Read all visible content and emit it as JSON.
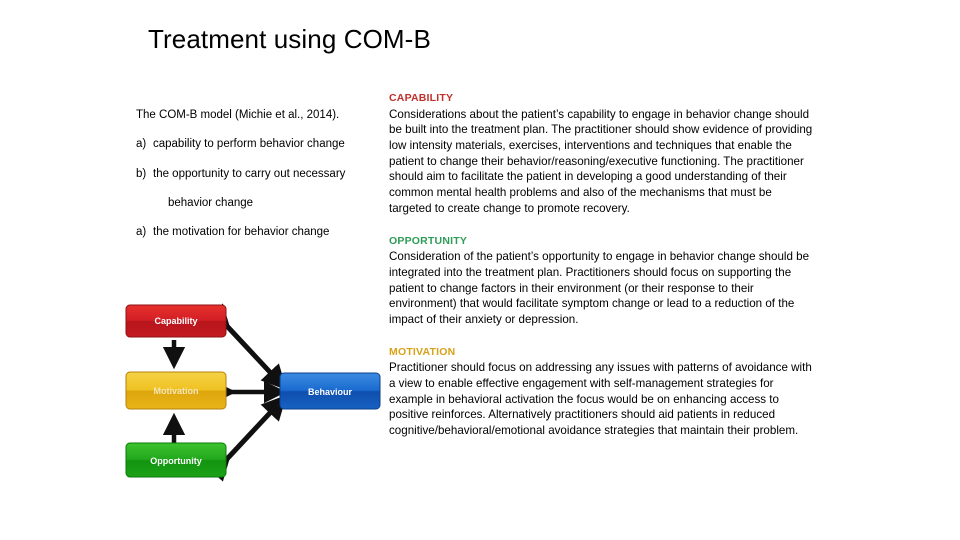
{
  "slide": {
    "title": "Treatment using COM-B"
  },
  "left_column": {
    "lead_paragraph": "The COM-B model (Michie et al., 2014).",
    "items": [
      {
        "marker": "a)",
        "text": "capability to perform behavior change"
      },
      {
        "marker": "b)",
        "text": "the opportunity to carry out necessary"
      }
    ],
    "indented_line": "behavior change",
    "final_item": {
      "marker": "a)",
      "text": "the motivation for behavior change"
    }
  },
  "diagram": {
    "name": "com-b-model-diagram",
    "nodes": [
      {
        "id": "capability",
        "label": "Capability",
        "color": "#D21F26"
      },
      {
        "id": "motivation",
        "label": "Motivation",
        "color": "#E8B114"
      },
      {
        "id": "opportunity",
        "label": "Opportunity",
        "color": "#22A81C"
      },
      {
        "id": "behaviour",
        "label": "Behaviour",
        "color": "#1461C6"
      }
    ],
    "arrows": [
      {
        "from": "capability",
        "to": "motivation",
        "style": "single"
      },
      {
        "from": "opportunity",
        "to": "motivation",
        "style": "single"
      },
      {
        "from": "motivation",
        "to": "behaviour",
        "style": "double"
      },
      {
        "from": "capability",
        "to": "behaviour",
        "style": "double"
      },
      {
        "from": "opportunity",
        "to": "behaviour",
        "style": "double"
      }
    ]
  },
  "right_column": {
    "sections": [
      {
        "heading": "CAPABILITY",
        "color": "#C0302B",
        "body": "Considerations about the patient’s capability to engage in behavior change should be built into the treatment plan.  The practitioner should show evidence of providing low intensity materials, exercises, interventions and techniques that enable the patient to change their behavior/reasoning/executive functioning.  The practitioner should aim to facilitate the patient in developing a good understanding of their common mental health problems and also of the mechanisms that must be targeted to create change to promote recovery."
      },
      {
        "heading": "OPPORTUNITY",
        "color": "#2E9B57",
        "body": "Consideration of the patient’s opportunity to engage in behavior change should be integrated into the treatment plan.  Practitioners should focus on supporting the patient to change factors in their environment (or their response to their environment) that would facilitate symptom change or lead to a reduction of the impact of their anxiety or depression."
      },
      {
        "heading": "MOTIVATION",
        "color": "#D7A219",
        "body": "Practitioner should focus on addressing any issues with patterns of avoidance with a view to enable effective engagement with self-management strategies for example in behavioral activation the focus would be on enhancing access to positive reinforces.  Alternatively practitioners should aid patients in reduced cognitive/behavioral/emotional avoidance strategies that maintain their problem."
      }
    ]
  }
}
